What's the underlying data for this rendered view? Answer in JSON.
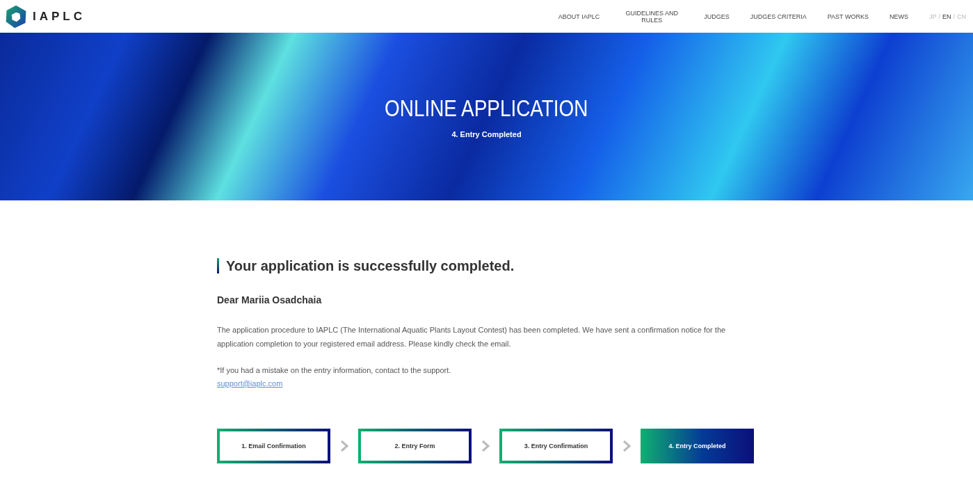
{
  "header": {
    "logo": "IAPLC",
    "nav": [
      "ABOUT IAPLC",
      "GUIDELINES AND RULES",
      "JUDGES",
      "JUDGES CRITERIA",
      "PAST WORKS",
      "NEWS"
    ],
    "language_separators": [
      "/",
      "/"
    ],
    "languages": [
      {
        "label": "JP",
        "selected": false
      },
      {
        "label": "EN",
        "selected": true
      },
      {
        "label": "CN",
        "selected": false
      }
    ]
  },
  "hero": {
    "title": "ONLINE APPLICATION",
    "subtitle": "4. Entry Completed"
  },
  "content": {
    "heading": "Your application is successfully completed.",
    "greeting": "Dear Mariia Osadchaia",
    "message": "The application procedure to IAPLC (The International Aquatic Plants Layout Contest) has been completed. We have sent a confirmation notice for the application completion to your registered email address. Please kindly check the email.",
    "note": "*If you had a mistake on the entry information, contact to the support.",
    "email": "support@iaplc.com"
  },
  "steps": [
    {
      "label": "1. Email Confirmation",
      "selected": false
    },
    {
      "label": "2. Entry Form",
      "selected": false
    },
    {
      "label": "3. Entry Confirmation",
      "selected": false
    },
    {
      "label": "4. Entry Completed",
      "selected": true
    }
  ]
}
